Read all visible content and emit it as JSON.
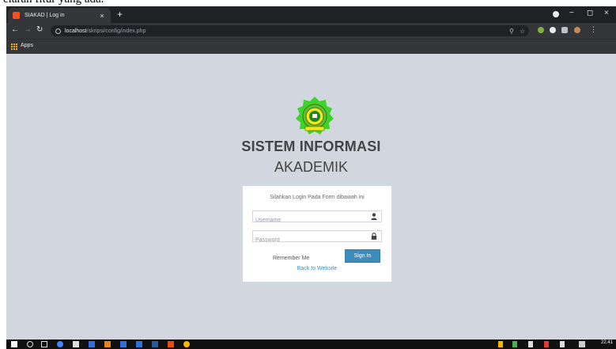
{
  "caption": "elaran fitur yang ada.",
  "browser": {
    "tab_title": "SIAKAD | Log in",
    "tab_close": "×",
    "new_tab": "+",
    "url_host": "localhost",
    "url_path": "/skripsi/config/index.php",
    "bookmarks": {
      "apps_label": "Apps"
    },
    "window_controls": {
      "minimize": "−",
      "maximize": "◻",
      "close": "×"
    }
  },
  "page": {
    "title_line1": "SISTEM INFORMASI",
    "title_line2": "AKADEMIK",
    "login": {
      "message": "Silahkan Login Pada Form dibawah ini",
      "username_placeholder": "Username",
      "password_placeholder": "Password",
      "remember_label": "Remember Me",
      "signin_label": "Sign In",
      "back_link": "Back to Website"
    }
  },
  "taskbar": {
    "clock": "22.41"
  },
  "colors": {
    "page_bg": "#d2d6de",
    "primary": "#3c8dbc",
    "chrome_dark": "#202124",
    "chrome_toolbar": "#35363a"
  }
}
